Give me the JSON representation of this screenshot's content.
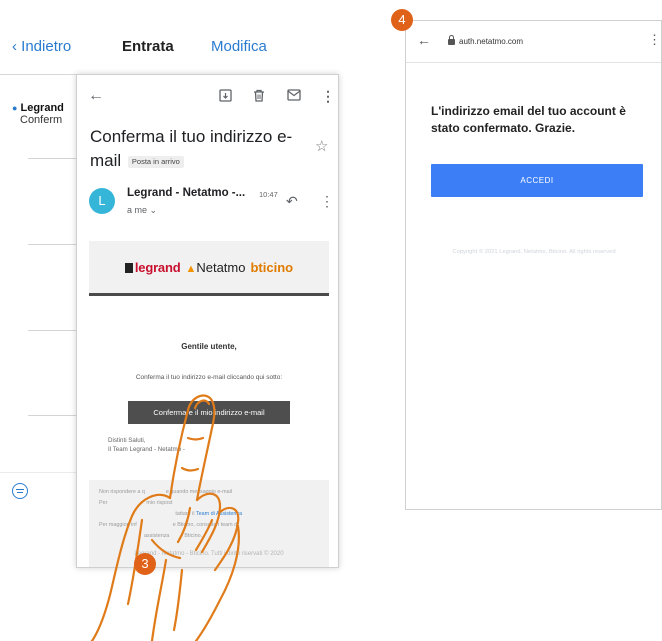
{
  "ios_mail": {
    "back_label": "Indietro",
    "title": "Entrata",
    "edit_label": "Modifica",
    "message_sender": "Legrand",
    "message_subject": "Conferm"
  },
  "gmail": {
    "subject": "Conferma il tuo indirizzo e-mail",
    "label_chip": "Posta in arrivo",
    "avatar_letter": "L",
    "sender": "Legrand - Netatmo -...",
    "time": "10:47",
    "recipient": "a me",
    "logos": {
      "legrand": "legrand",
      "netatmo": "Netatmo",
      "bticino": "bticino"
    },
    "greeting": "Gentile utente,",
    "body_text": "Conferma il tuo indirizzo e-mail cliccando qui sotto:",
    "confirm_button": "Confermare il mio indirizzo e-mail",
    "signoff": "Distinti Saluti,",
    "team": "Il Team Legrand - Netatmo -",
    "footer_1": "Non rispondere a q",
    "footer_1b": "e quando messaggio e-mail",
    "footer_2": "Per",
    "footer_2b": "mio rispost",
    "footer_2c": "tattare il",
    "footer_link": "Team di Assistenza",
    "footer_3": "Per maggiori inf",
    "footer_3b": "e Bticino, consulta i team di",
    "footer_4": "assistenza",
    "footer_4b": "Bticino.",
    "copyright": "Legrand - Netatmo - Bticino. Tutti i diritti riservati © 2020"
  },
  "browser": {
    "url": "auth.netatmo.com",
    "message": "L'indirizzo email del tuo account è stato confermato. Grazie.",
    "button": "ACCEDI",
    "copyright": "Copyright © 2021 Legrand, Netatmo, Bticino. All rights reserved"
  },
  "markers": {
    "step3": "3",
    "step4": "4"
  },
  "colors": {
    "ios_blue": "#2a7bd0",
    "marker_orange": "#e06219",
    "accedi_blue": "#3b7ef5",
    "gmail_button": "#4e4e4e",
    "legrand_red": "#c8102e"
  }
}
